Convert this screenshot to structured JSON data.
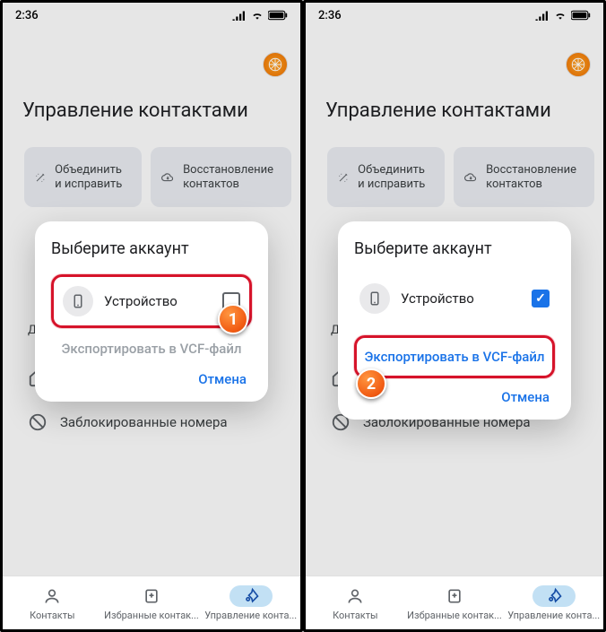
{
  "status": {
    "time": "2:36"
  },
  "page": {
    "title": "Управление контактами"
  },
  "cards": {
    "merge_label": "Объединить и исправить",
    "restore_label": "Восстановление контактов"
  },
  "section": {
    "other_label": "Др"
  },
  "bg_rows": {
    "blocked": "Заблокированные номера"
  },
  "dialog": {
    "title": "Выберите аккаунт",
    "account_device": "Устройство",
    "export_label": "Экспортировать в VCF-файл",
    "cancel": "Отмена"
  },
  "callouts": {
    "one": "1",
    "two": "2"
  },
  "tabs": {
    "contacts": "Контакты",
    "favorites": "Избранные контак...",
    "manage": "Управление конта..."
  }
}
